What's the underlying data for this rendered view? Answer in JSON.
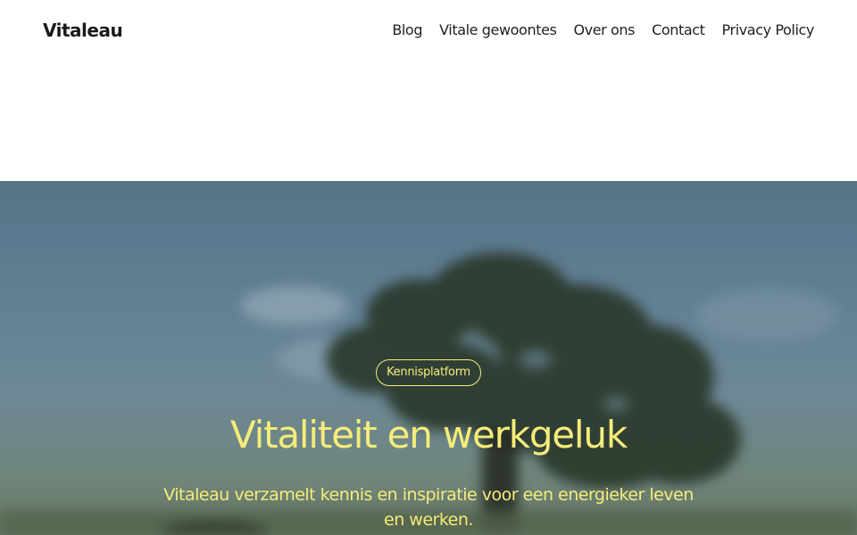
{
  "header": {
    "brand": "Vitaleau",
    "nav": [
      "Blog",
      "Vitale gewoontes",
      "Over ons",
      "Contact",
      "Privacy Policy"
    ]
  },
  "hero": {
    "badge": "Kennisplatform",
    "title": "Vitaliteit en werkgeluk",
    "subtitle": "Vitaleau verzamelt kennis en inspiratie voor een energieker leven en werken."
  },
  "colors": {
    "accent": "#f6ec7a",
    "text": "#1f1f1f",
    "background": "#ffffff"
  }
}
